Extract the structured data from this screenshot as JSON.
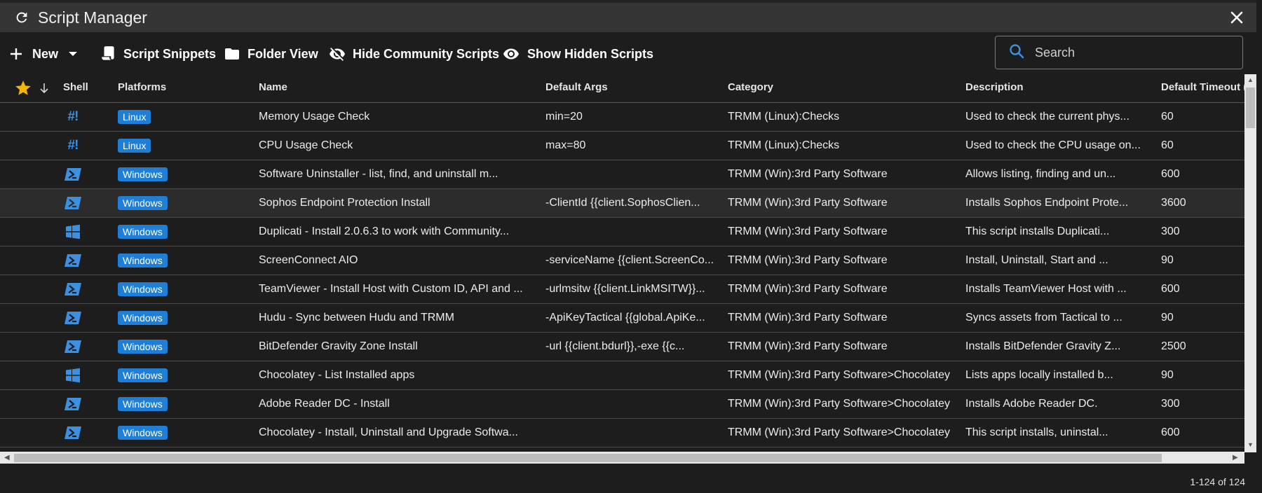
{
  "window": {
    "title": "Script Manager"
  },
  "toolbar": {
    "new_label": "New",
    "snippets_label": "Script Snippets",
    "folder_view_label": "Folder View",
    "hide_community_label": "Hide Community Scripts",
    "show_hidden_label": "Show Hidden Scripts"
  },
  "search": {
    "placeholder": "Search"
  },
  "columns": {
    "shell": "Shell",
    "platforms": "Platforms",
    "name": "Name",
    "default_args": "Default Args",
    "category": "Category",
    "description": "Description",
    "default_timeout": "Default Timeout (seconds)"
  },
  "rows": [
    {
      "shell": "bash",
      "platform": "Linux",
      "name": "Memory Usage Check",
      "args": "min=20",
      "category": "TRMM (Linux):Checks",
      "description": "Used to check the current phys...",
      "timeout": "60"
    },
    {
      "shell": "bash",
      "platform": "Linux",
      "name": "CPU Usage Check",
      "args": "max=80",
      "category": "TRMM (Linux):Checks",
      "description": "Used to check the CPU usage on...",
      "timeout": "60"
    },
    {
      "shell": "powershell",
      "platform": "Windows",
      "name": "Software Uninstaller - list, find, and uninstall m...",
      "args": "",
      "category": "TRMM (Win):3rd Party Software",
      "description": "Allows listing, finding and un...",
      "timeout": "600"
    },
    {
      "shell": "powershell",
      "platform": "Windows",
      "name": "Sophos Endpoint Protection Install",
      "args": "-ClientId {{client.SophosClien...",
      "category": "TRMM (Win):3rd Party Software",
      "description": "Installs Sophos Endpoint Prote...",
      "timeout": "3600"
    },
    {
      "shell": "cmd",
      "platform": "Windows",
      "name": "Duplicati - Install 2.0.6.3 to work with Community...",
      "args": "",
      "category": "TRMM (Win):3rd Party Software",
      "description": "This script installs Duplicati...",
      "timeout": "300"
    },
    {
      "shell": "powershell",
      "platform": "Windows",
      "name": "ScreenConnect AIO",
      "args": "-serviceName {{client.ScreenCo...",
      "category": "TRMM (Win):3rd Party Software",
      "description": "Install, Uninstall, Start and ...",
      "timeout": "90"
    },
    {
      "shell": "powershell",
      "platform": "Windows",
      "name": "TeamViewer - Install Host with Custom ID, API and ...",
      "args": "-urlmsitw {{client.LinkMSITW}}...",
      "category": "TRMM (Win):3rd Party Software",
      "description": "Installs TeamViewer Host with ...",
      "timeout": "600"
    },
    {
      "shell": "powershell",
      "platform": "Windows",
      "name": "Hudu - Sync between Hudu and TRMM",
      "args": "-ApiKeyTactical {{global.ApiKe...",
      "category": "TRMM (Win):3rd Party Software",
      "description": "Syncs assets from Tactical to ...",
      "timeout": "90"
    },
    {
      "shell": "powershell",
      "platform": "Windows",
      "name": "BitDefender Gravity Zone Install",
      "args": "-url {{client.bdurl}},-exe {{c...",
      "category": "TRMM (Win):3rd Party Software",
      "description": "Installs BitDefender Gravity Z...",
      "timeout": "2500"
    },
    {
      "shell": "cmd",
      "platform": "Windows",
      "name": "Chocolatey - List Installed apps",
      "args": "",
      "category": "TRMM (Win):3rd Party Software>Chocolatey",
      "description": "Lists apps locally installed b...",
      "timeout": "90"
    },
    {
      "shell": "powershell",
      "platform": "Windows",
      "name": "Adobe Reader DC - Install",
      "args": "",
      "category": "TRMM (Win):3rd Party Software>Chocolatey",
      "description": "Installs Adobe Reader DC.",
      "timeout": "300"
    },
    {
      "shell": "powershell",
      "platform": "Windows",
      "name": "Chocolatey - Install, Uninstall and Upgrade Softwa...",
      "args": "",
      "category": "TRMM (Win):3rd Party Software>Chocolatey",
      "description": "This script installs, uninstal...",
      "timeout": "600"
    }
  ],
  "footer": {
    "pagination": "1-124 of 124"
  },
  "colors": {
    "accent": "#1f7fd6",
    "favorite_star": "#f5b400",
    "background": "#1d1d1d",
    "titlebar": "#353535"
  }
}
